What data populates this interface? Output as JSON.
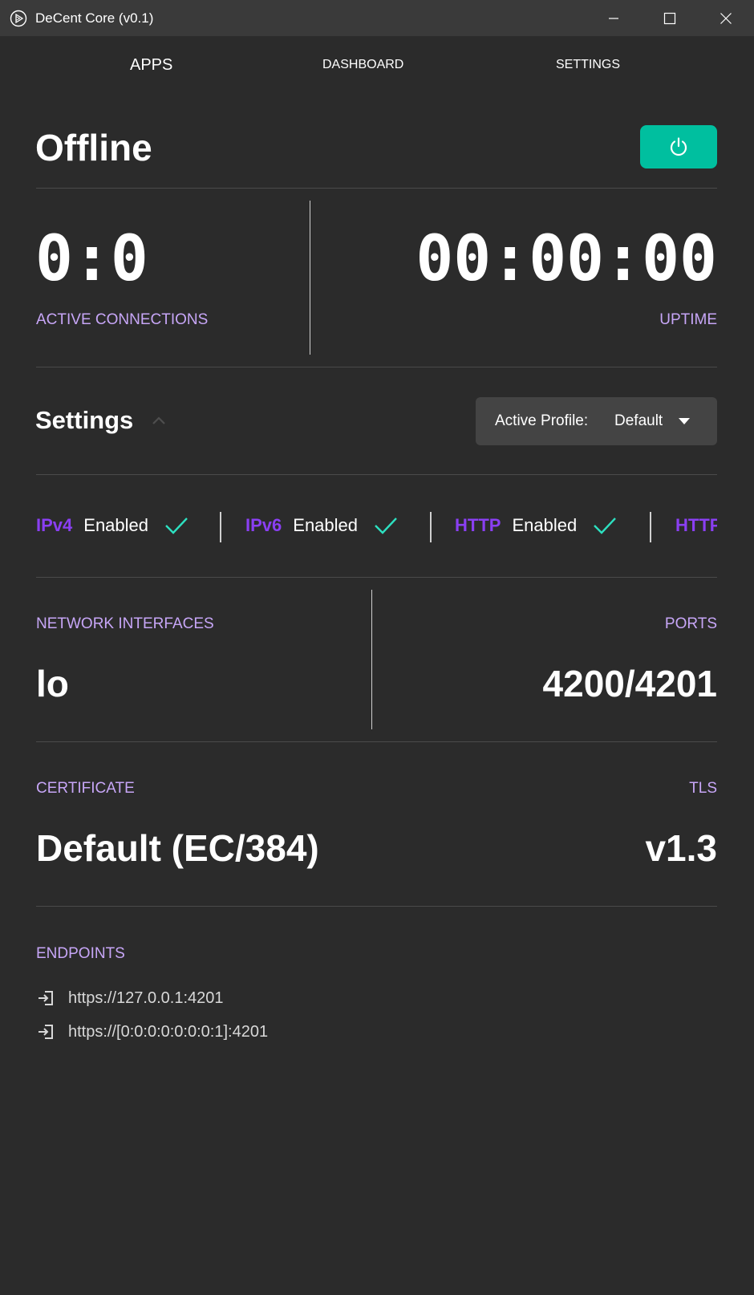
{
  "window": {
    "title": "DeCent Core (v0.1)"
  },
  "nav": {
    "apps": "APPS",
    "dashboard": "DASHBOARD",
    "settings": "SETTINGS"
  },
  "status": {
    "title": "Offline",
    "power_color": "#00bf9f"
  },
  "stats": {
    "connections_value": "0:0",
    "connections_label": "ACTIVE CONNECTIONS",
    "uptime_value": "00:00:00",
    "uptime_label": "UPTIME"
  },
  "settings": {
    "title": "Settings",
    "profile_label": "Active Profile:",
    "profile_value": "Default"
  },
  "protocols": [
    {
      "name": "IPv4",
      "state": "Enabled"
    },
    {
      "name": "IPv6",
      "state": "Enabled"
    },
    {
      "name": "HTTP",
      "state": "Enabled"
    },
    {
      "name": "HTTP"
    }
  ],
  "network": {
    "interfaces_label": "NETWORK INTERFACES",
    "interfaces_value": "lo",
    "ports_label": "PORTS",
    "ports_value": "4200/4201"
  },
  "security": {
    "certificate_label": "CERTIFICATE",
    "certificate_value": "Default (EC/384)",
    "tls_label": "TLS",
    "tls_value": "v1.3"
  },
  "endpoints": {
    "label": "ENDPOINTS",
    "items": [
      "https://127.0.0.1:4201",
      "https://[0:0:0:0:0:0:0:1]:4201"
    ]
  },
  "colors": {
    "background": "#2b2b2b",
    "accent_purple": "#8a3ff2",
    "label_purple": "#c7a6f7",
    "check_teal": "#2de0c0"
  },
  "icons": [
    "app-logo-icon",
    "minimize-icon",
    "maximize-icon",
    "close-icon",
    "power-icon",
    "chevron-up-icon",
    "dropdown-arrow-icon",
    "check-icon",
    "login-arrow-icon"
  ]
}
